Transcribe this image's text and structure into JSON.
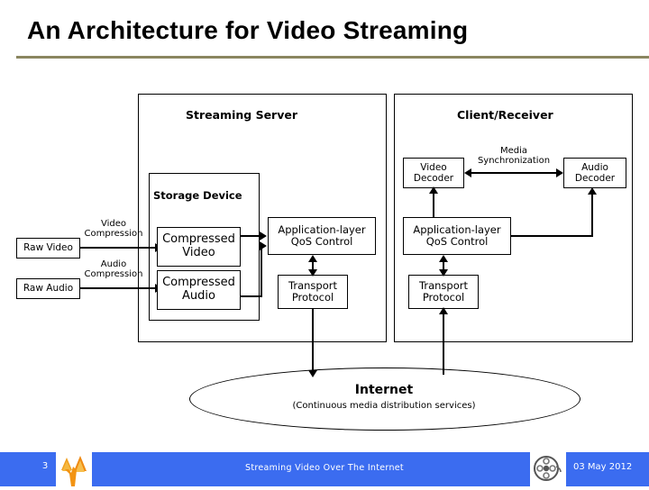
{
  "slide": {
    "title": "An Architecture for Video Streaming",
    "accent_rule_color": "#8a8660"
  },
  "diagram": {
    "server_panel_title": "Streaming Server",
    "client_panel_title": "Client/Receiver",
    "storage_title": "Storage Device",
    "boxes": {
      "raw_video": "Raw Video",
      "raw_audio": "Raw Audio",
      "compressed_video": "Compressed\nVideo",
      "compressed_audio": "Compressed\nAudio",
      "server_qos": "Application-layer\nQoS Control",
      "server_transport": "Transport\nProtocol",
      "client_qos": "Application-layer\nQoS Control",
      "client_transport": "Transport\nProtocol",
      "video_decoder": "Video\nDecoder",
      "audio_decoder": "Audio\nDecoder"
    },
    "labels": {
      "video_compression": "Video\nCompression",
      "audio_compression": "Audio\nCompression",
      "media_synchronization": "Media\nSynchronization"
    },
    "internet": {
      "title": "Internet",
      "subtitle": "(Continuous media distribution services)"
    }
  },
  "footer": {
    "page_number": "3",
    "center_text": "Streaming Video Over The Internet",
    "date": "03 May 2012",
    "bar_color": "#3b6cf0",
    "logo_icon": "tree-logo-icon",
    "reel_icon": "film-reel-icon"
  }
}
